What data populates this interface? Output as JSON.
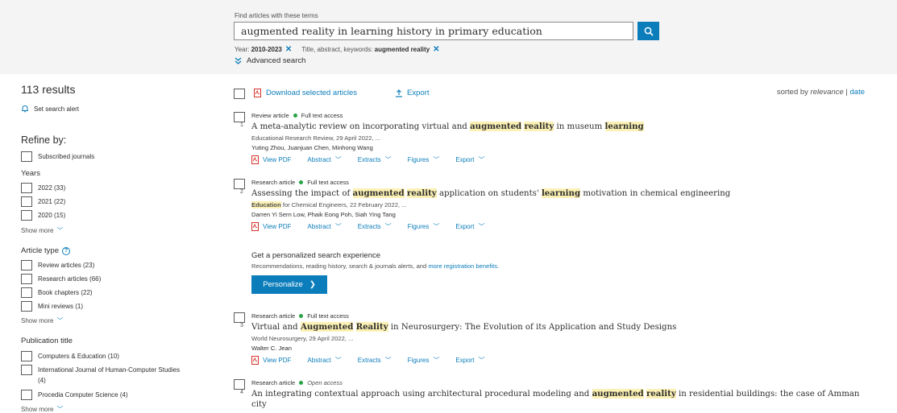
{
  "search": {
    "label": "Find articles with these terms",
    "query": "augmented reality in learning history in primary education",
    "filters": [
      {
        "prefix": "Year: ",
        "value": "2010-2023"
      },
      {
        "prefix": "Title, abstract, keywords: ",
        "value": "augmented reality"
      }
    ],
    "advanced_label": "Advanced search"
  },
  "sidebar": {
    "results_count": "113 results",
    "alert_label": "Set search alert",
    "refine_label": "Refine by:",
    "subscribed_label": "Subscribed journals",
    "years_heading": "Years",
    "years": [
      "2022 (33)",
      "2021 (22)",
      "2020 (15)"
    ],
    "show_more": "Show more",
    "article_type_heading": "Article type",
    "article_types": [
      "Review articles (23)",
      "Research articles (66)",
      "Book chapters (22)",
      "Mini reviews (1)"
    ],
    "publication_heading": "Publication title",
    "publications": [
      "Computers & Education (10)",
      "International Journal of Human-Computer Studies",
      "(4)",
      "Procedia Computer Science (4)"
    ]
  },
  "toolbar": {
    "download_label": "Download selected articles",
    "export_label": "Export",
    "sorted_prefix": "sorted by ",
    "sort_relevance": "relevance",
    "sort_sep": " | ",
    "sort_date": "date"
  },
  "results": [
    {
      "num": "1",
      "type": "Review article",
      "access": "Full text access",
      "title_parts": [
        {
          "t": "A meta-analytic review on incorporating virtual and ",
          "h": false
        },
        {
          "t": "augmented",
          "h": true
        },
        {
          "t": " ",
          "h": false
        },
        {
          "t": "reality",
          "h": true
        },
        {
          "t": " in museum ",
          "h": false
        },
        {
          "t": "learning",
          "h": true
        }
      ],
      "source_parts": [
        {
          "t": "Educational Research Review, 29 April 2022, ...",
          "h": false
        }
      ],
      "authors": "Yuting Zhou, Juanjuan Chen, Minhong Wang"
    },
    {
      "num": "2",
      "type": "Research article",
      "access": "Full text access",
      "title_parts": [
        {
          "t": "Assessing the impact of ",
          "h": false
        },
        {
          "t": "augmented",
          "h": true
        },
        {
          "t": " ",
          "h": false
        },
        {
          "t": "reality",
          "h": true
        },
        {
          "t": " application on students' ",
          "h": false
        },
        {
          "t": "learning",
          "h": true
        },
        {
          "t": " motivation in chemical engineering",
          "h": false
        }
      ],
      "source_parts": [
        {
          "t": "Education",
          "h": true
        },
        {
          "t": " for Chemical Engineers, 22 February 2022, ...",
          "h": false
        }
      ],
      "authors": "Darren Yi Sern Low, Phaik Eong Poh, Siah Ying Tang"
    },
    {
      "num": "3",
      "type": "Research article",
      "access": "Full text access",
      "title_parts": [
        {
          "t": "Virtual and ",
          "h": false
        },
        {
          "t": "Augmented",
          "h": true
        },
        {
          "t": " ",
          "h": false
        },
        {
          "t": "Reality",
          "h": true
        },
        {
          "t": " in Neurosurgery: The Evolution of its Application and Study Designs",
          "h": false
        }
      ],
      "source_parts": [
        {
          "t": "World Neurosurgery, 29 April 2022, ...",
          "h": false
        }
      ],
      "authors": "Walter C. Jean"
    },
    {
      "num": "4",
      "type": "Research article",
      "access": "Open access",
      "title_parts": [
        {
          "t": "An integrating contextual approach using architectural procedural modeling and ",
          "h": false
        },
        {
          "t": "augmented",
          "h": true
        },
        {
          "t": " ",
          "h": false
        },
        {
          "t": "reality",
          "h": true
        },
        {
          "t": " in residential buildings: the case of Amman",
          "h": false
        }
      ],
      "title_line2": "city"
    }
  ],
  "actions": {
    "view_pdf": "View PDF",
    "abstract": "Abstract",
    "extracts": "Extracts",
    "figures": "Figures",
    "export": "Export"
  },
  "promo": {
    "title": "Get a personalized search experience",
    "text": "Recommendations, reading history, search & journals alerts, and ",
    "link": "more registration benefits",
    "text_end": ".",
    "button": "Personalize"
  },
  "colors": {
    "accent": "#0c7dbb",
    "highlight": "#fcf1b4",
    "access_dot": "#26a345"
  }
}
